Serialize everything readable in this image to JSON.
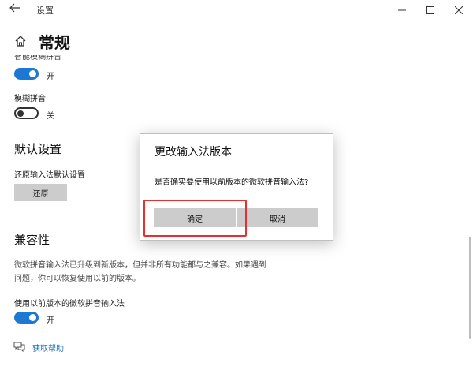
{
  "window": {
    "title": "设置",
    "controls": {
      "minimize": "—",
      "maximize": "☐",
      "close": "✕"
    }
  },
  "page": {
    "title": "常规"
  },
  "settings": {
    "cut_off_label": "智能模糊拼音",
    "toggle1": {
      "state": "开",
      "on": true
    },
    "fuzzy": {
      "label": "模糊拼音",
      "state": "关",
      "on": false
    },
    "default_section": {
      "heading": "默认设置",
      "label": "还原输入法默认设置",
      "button": "还原"
    },
    "compat_section": {
      "heading": "兼容性",
      "description_line1": "微软拼音输入法已升级到新版本，但并非所有功能都与之兼容。如果遇到",
      "description_line2": "问题，你可以恢复使用以前的版本。",
      "prev_version_label": "使用以前版本的微软拼音输入法",
      "prev_version_state": "开",
      "prev_version_on": true
    }
  },
  "help": {
    "link": "获取帮助",
    "icon": "chat-help-icon"
  },
  "dialog": {
    "title": "更改输入法版本",
    "message": "是否确实要使用以前版本的微软拼音输入法?",
    "ok": "确定",
    "cancel": "取消"
  },
  "colors": {
    "accent": "#1c79d3",
    "highlight_box": "#e53030",
    "button_bg": "#cccccc",
    "link": "#1a6fbf"
  }
}
